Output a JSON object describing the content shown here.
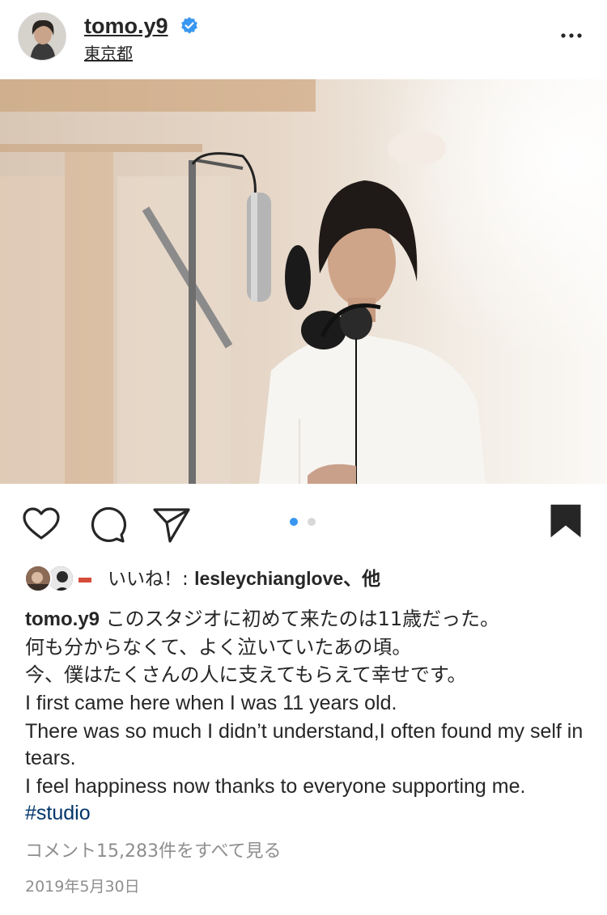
{
  "header": {
    "username": "tomo.y9",
    "location": "東京都"
  },
  "post": {
    "carousel_total": 2,
    "carousel_active": 1
  },
  "likes": {
    "prefix": "いいね！: ",
    "user": "lesleychianglove",
    "suffix": "、他"
  },
  "caption": {
    "username": "tomo.y9",
    "line1": " このスタジオに初めて来たのは11歳だった。",
    "line2": "何も分からなくて、よく泣いていたあの頃。",
    "line3": "今、僕はたくさんの人に支えてもらえて幸せです。",
    "line4": "I first came here when I was 11 years old.",
    "line5": "There was so much I didn’t understand,I often found my self in tears.",
    "line6": "I feel happiness now thanks to everyone supporting me. ",
    "hashtag": "#studio"
  },
  "comments_link": "コメント15,283件をすべて見る",
  "date": "2019年5月30日",
  "colors": {
    "verified": "#3897f0",
    "hashtag": "#003569",
    "muted": "#8e8e8e",
    "dot_active": "#3897f0",
    "dot_inactive": "#d8d8d8"
  }
}
